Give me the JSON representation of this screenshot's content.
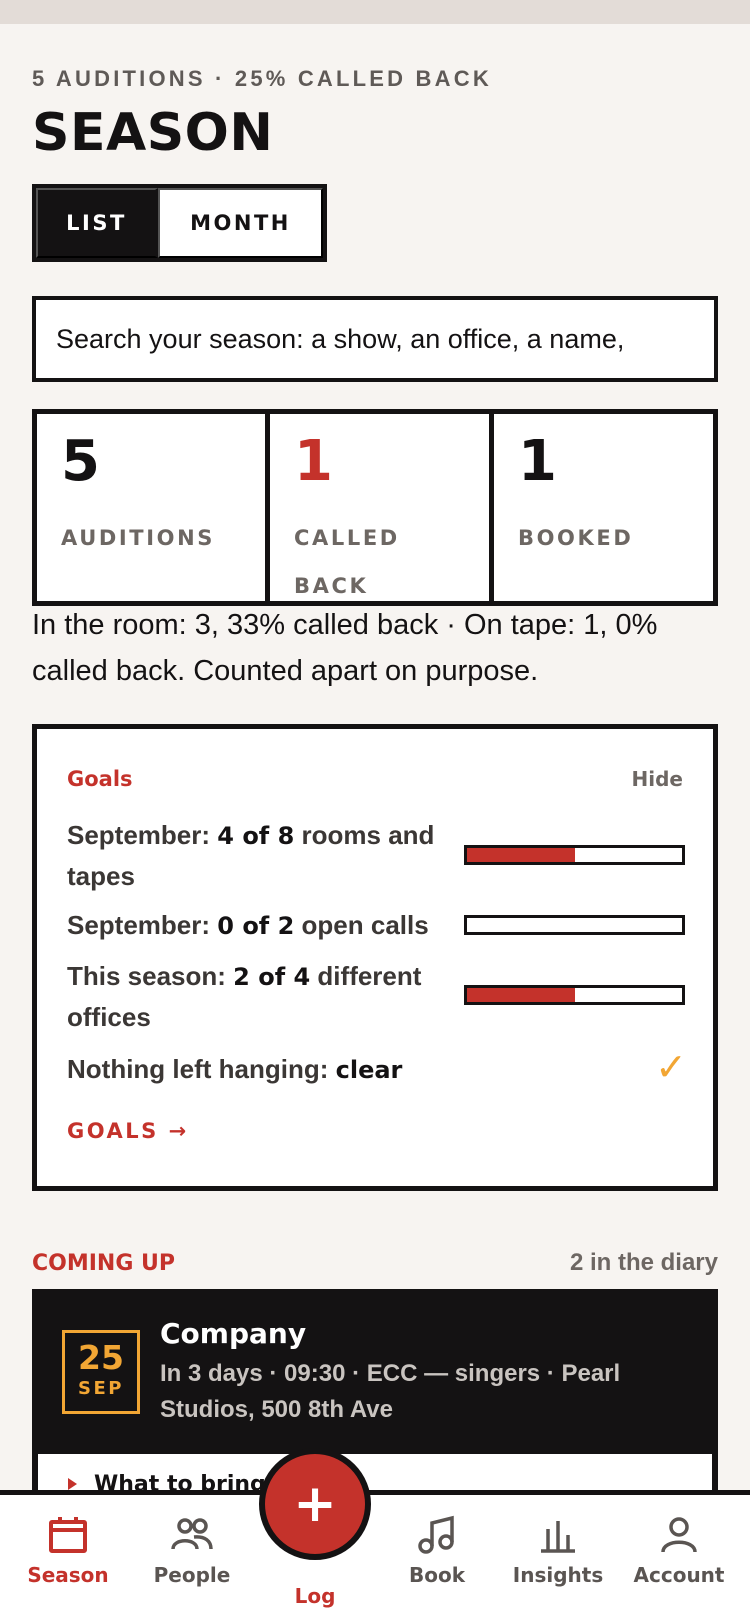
{
  "header": {
    "kicker": "5 AUDITIONS · 25% CALLED BACK",
    "title": "SEASON"
  },
  "view_toggle": {
    "list_label": "LIST",
    "month_label": "MONTH",
    "selected": "LIST"
  },
  "search": {
    "placeholder": "Search your season: a show, an office, a name,"
  },
  "stats": [
    {
      "value": "5",
      "label": "AUDITIONS"
    },
    {
      "value": "1",
      "label": "CALLED BACK"
    },
    {
      "value": "1",
      "label": "BOOKED"
    }
  ],
  "split_note": "In the room: 3, 33% called back · On tape: 1, 0% called back. Counted apart on purpose.",
  "goals": {
    "title": "Goals",
    "hide_label": "Hide",
    "items": [
      {
        "prefix": "September: ",
        "count": "4 of 8",
        "suffix": " rooms and tapes",
        "progress": 0.5
      },
      {
        "prefix": "September: ",
        "count": "0 of 2",
        "suffix": " open calls",
        "progress": 0
      },
      {
        "prefix": "This season: ",
        "count": "2 of 4",
        "suffix": " different offices",
        "progress": 0.5
      }
    ],
    "hanging": {
      "prefix": "Nothing left hanging: ",
      "status": "clear",
      "check_icon": "checkmark-icon"
    },
    "link_label": "GOALS →"
  },
  "coming_up": {
    "title": "COMING UP",
    "count": "2 in the diary",
    "event": {
      "day": "25",
      "month": "SEP",
      "title": "Company",
      "meta": "In 3 days · 09:30 · ECC — singers · Pearl Studios, 500 8th Ave",
      "panel_label": "What to bring"
    }
  },
  "tab_bar": {
    "tabs": [
      {
        "label": "Season",
        "icon": "calendar-icon",
        "active": true
      },
      {
        "label": "People",
        "icon": "people-icon",
        "active": false
      },
      {
        "label": "Log",
        "icon": "plus-icon",
        "active": false
      },
      {
        "label": "Book",
        "icon": "music-note-icon",
        "active": false
      },
      {
        "label": "Insights",
        "icon": "bar-chart-icon",
        "active": false
      },
      {
        "label": "Account",
        "icon": "user-icon",
        "active": false
      }
    ],
    "log_symbol": "+"
  },
  "colors": {
    "accent_red": "#c4322b",
    "ink": "#141213",
    "background": "#f7f4f1",
    "gold": "#f2a634",
    "muted": "#6d6763"
  }
}
